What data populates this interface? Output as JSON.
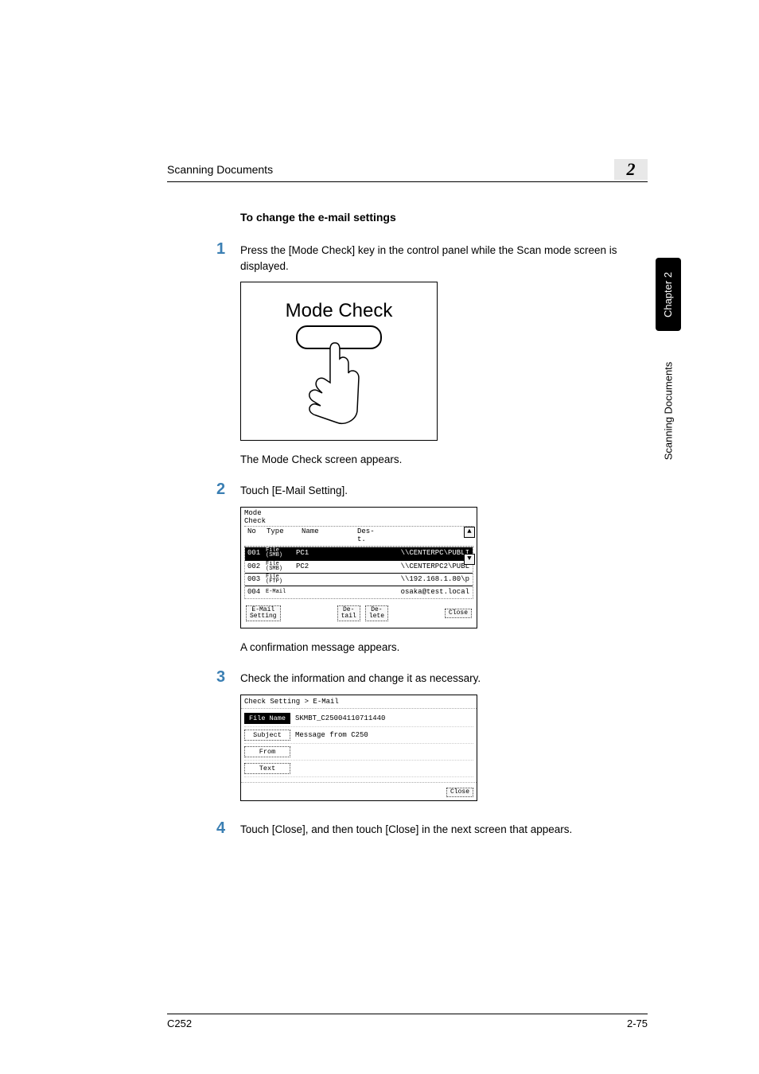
{
  "header": {
    "section": "Scanning Documents",
    "chapter_num": "2"
  },
  "side": {
    "tab": "Chapter 2",
    "label": "Scanning Documents"
  },
  "heading": "To change the e-mail settings",
  "steps": {
    "s1": {
      "num": "1",
      "text": "Press the [Mode Check] key in the control panel while the Scan mode screen is displayed."
    },
    "s2": {
      "num": "2",
      "text": "Touch [E-Mail Setting]."
    },
    "s3": {
      "num": "3",
      "text": "Check the information and change it as necessary."
    },
    "s4": {
      "num": "4",
      "text": "Touch [Close], and then touch [Close] in the next screen that appears."
    }
  },
  "illus1": {
    "label": "Mode Check"
  },
  "result1": "The Mode Check screen appears.",
  "result2": "A confirmation message appears.",
  "screen1": {
    "title": "Mode\nCheck",
    "headers": {
      "no": "No",
      "type": "Type",
      "name": "Name",
      "dest": "Des-\nt."
    },
    "rows": [
      {
        "no": "001",
        "type": "File\n(SMB)",
        "name": "PC1",
        "dest": "\\\\CENTERPC\\PUBLI"
      },
      {
        "no": "002",
        "type": "File\n(SMB)",
        "name": "PC2",
        "dest": "\\\\CENTERPC2\\PUBL"
      },
      {
        "no": "003",
        "type": "File\n(FTP)",
        "name": "",
        "dest": "\\\\192.168.1.80\\p"
      },
      {
        "no": "004",
        "type": "E-Mail",
        "name": "",
        "dest": "osaka@test.local"
      }
    ],
    "buttons": {
      "email": "E-Mail\nSetting",
      "detail": "De-\ntail",
      "delete": "De-\nlete",
      "close": "Close"
    }
  },
  "screen2": {
    "title": "Check Setting > E-Mail",
    "rows": {
      "filename": {
        "label": "File Name",
        "value": "SKMBT_C25004110711440"
      },
      "subject": {
        "label": "Subject",
        "value": "Message from C250"
      },
      "from": {
        "label": "From",
        "value": ""
      },
      "text": {
        "label": "Text",
        "value": ""
      }
    },
    "close": "Close"
  },
  "footer": {
    "left": "C252",
    "right": "2-75"
  }
}
